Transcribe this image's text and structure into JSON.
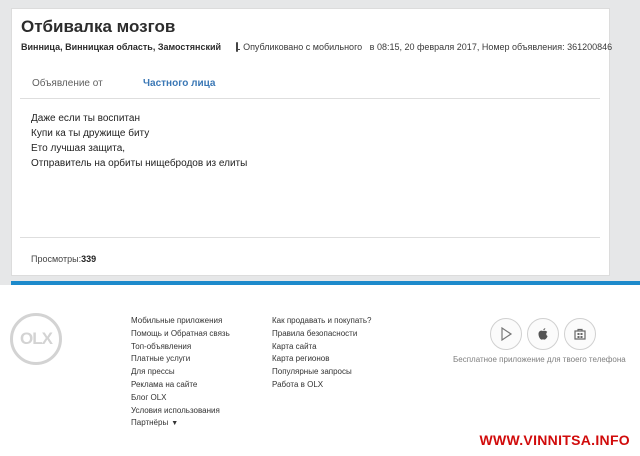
{
  "ad": {
    "title": "Отбивалка мозгов",
    "location": "Винница, Винницкая область, Замостянский",
    "published": "Опубликовано с мобильного   в 08:15, 20 февраля 2017, Номер объявления: 361200846",
    "seller_label": "Объявление от",
    "seller_value": "Частного лица",
    "text_lines": [
      "Даже если ты воспитан",
      "Купи ка ты дружище биту",
      "Ето лучшая защита,",
      "Отправитель на орбиты нищебродов из елиты"
    ],
    "views_label": "Просмотры:",
    "views_count": "339"
  },
  "footer": {
    "logo_text": "OLX",
    "col1": [
      "Мобильные приложения",
      "Помощь и Обратная связь",
      "Топ-объявления",
      "Платные услуги",
      "Для прессы",
      "Реклама на сайте",
      "Блог OLX",
      "Условия использования",
      "Партнёры"
    ],
    "col2": [
      "Как продавать и покупать?",
      "Правила безопасности",
      "Карта сайта",
      "Карта регионов",
      "Популярные запросы",
      "Работа в OLX"
    ],
    "app_caption": "Бесплатное приложение для твоего телефона",
    "store_icons": [
      "google-play-icon",
      "apple-icon",
      "windows-store-icon"
    ]
  },
  "watermark": "WWW.VINNITSA.INFO",
  "colors": {
    "accent_blue": "#1d8acb",
    "link_blue": "#3a77b5",
    "watermark_red": "#d10b0b"
  }
}
